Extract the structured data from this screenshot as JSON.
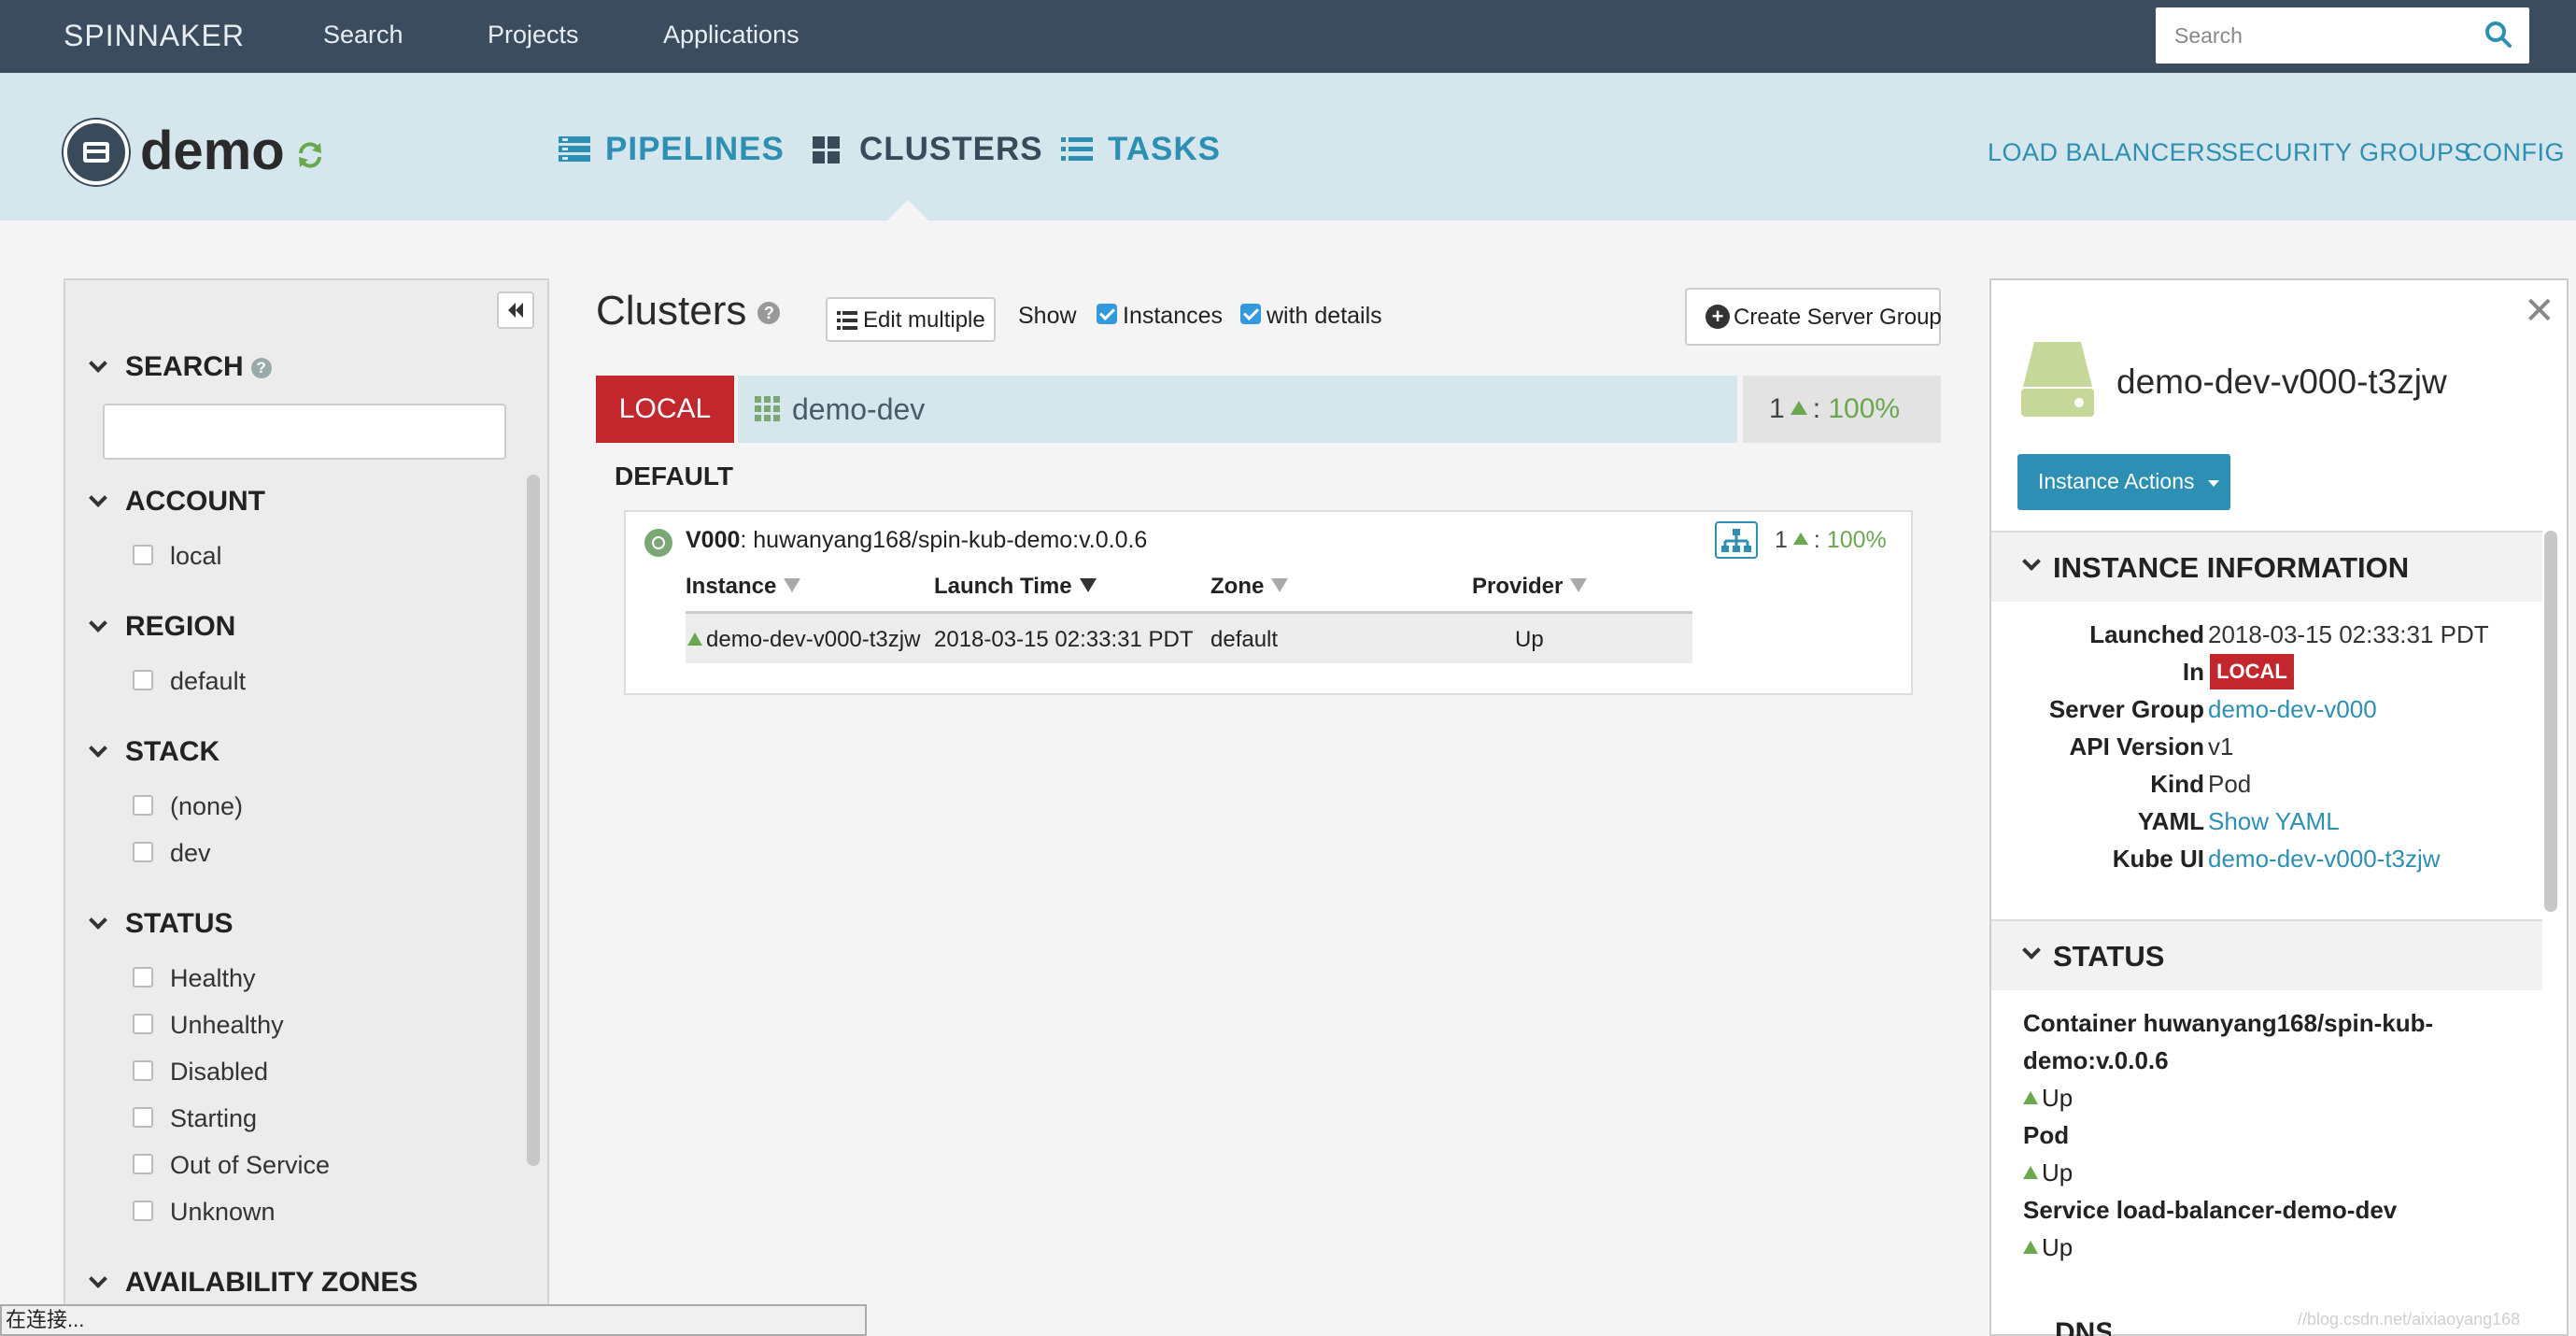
{
  "topnav": {
    "brand": "SPINNAKER",
    "links": [
      "Search",
      "Projects",
      "Applications"
    ],
    "search_placeholder": "Search"
  },
  "app": {
    "name": "demo",
    "tabs": [
      "PIPELINES",
      "CLUSTERS",
      "TASKS"
    ],
    "active_tab": "CLUSTERS",
    "right_links": [
      "LOAD BALANCERS",
      "SECURITY GROUPS",
      "CONFIG"
    ]
  },
  "filters": {
    "search_heading": "SEARCH",
    "sections": [
      {
        "heading": "ACCOUNT",
        "items": [
          "local"
        ]
      },
      {
        "heading": "REGION",
        "items": [
          "default"
        ]
      },
      {
        "heading": "STACK",
        "items": [
          "(none)",
          "dev"
        ]
      },
      {
        "heading": "STATUS",
        "items": [
          "Healthy",
          "Unhealthy",
          "Disabled",
          "Starting",
          "Out of Service",
          "Unknown"
        ]
      },
      {
        "heading": "AVAILABILITY ZONES",
        "items": []
      }
    ]
  },
  "clusters": {
    "title": "Clusters",
    "edit_multiple": "Edit multiple",
    "show_label": "Show",
    "show_instances": "Instances",
    "show_details": "with details",
    "create_server_group": "Create Server Group",
    "account_tag": "LOCAL",
    "cluster_name": "demo-dev",
    "cluster_health_count": "1",
    "cluster_health_pct": "100%",
    "region_label": "DEFAULT",
    "server_group": {
      "version": "V000",
      "image": ": huwanyang168/spin-kub-demo:v.0.0.6",
      "health_count": "1",
      "health_pct": "100%",
      "columns": [
        "Instance",
        "Launch Time",
        "Zone",
        "Provider"
      ],
      "rows": [
        {
          "instance": "demo-dev-v000-t3zjw",
          "launch_time": "2018-03-15 02:33:31 PDT",
          "zone": "default",
          "provider": "Up"
        }
      ]
    }
  },
  "details": {
    "title": "demo-dev-v000-t3zjw",
    "actions_button": "Instance Actions",
    "instance_info_heading": "INSTANCE INFORMATION",
    "info": {
      "launched_label": "Launched",
      "launched": "2018-03-15 02:33:31 PDT",
      "in_label": "In",
      "in": "LOCAL",
      "server_group_label": "Server Group",
      "server_group": "demo-dev-v000",
      "api_version_label": "API Version",
      "api_version": "v1",
      "kind_label": "Kind",
      "kind": "Pod",
      "yaml_label": "YAML",
      "yaml": "Show YAML",
      "kube_ui_label": "Kube UI",
      "kube_ui": "demo-dev-v000-t3zjw"
    },
    "status_heading": "STATUS",
    "status": {
      "container_line1": "Container huwanyang168/spin-kub-",
      "container_line2": "demo:v.0.0.6",
      "container_state": "Up",
      "pod": "Pod",
      "pod_state": "Up",
      "service": "Service load-balancer-demo-dev",
      "service_state": "Up"
    },
    "next_heading_fragment": "DNS"
  },
  "statusbar": "在连接...",
  "watermark": "//blog.csdn.net/aixiaoyang168",
  "colors": {
    "topnav_bg": "#3b4c5e",
    "header_bg": "#d6e6ed",
    "accent": "#2c8fb3",
    "local_red": "#c1272d",
    "healthy_green": "#6aa84f"
  }
}
